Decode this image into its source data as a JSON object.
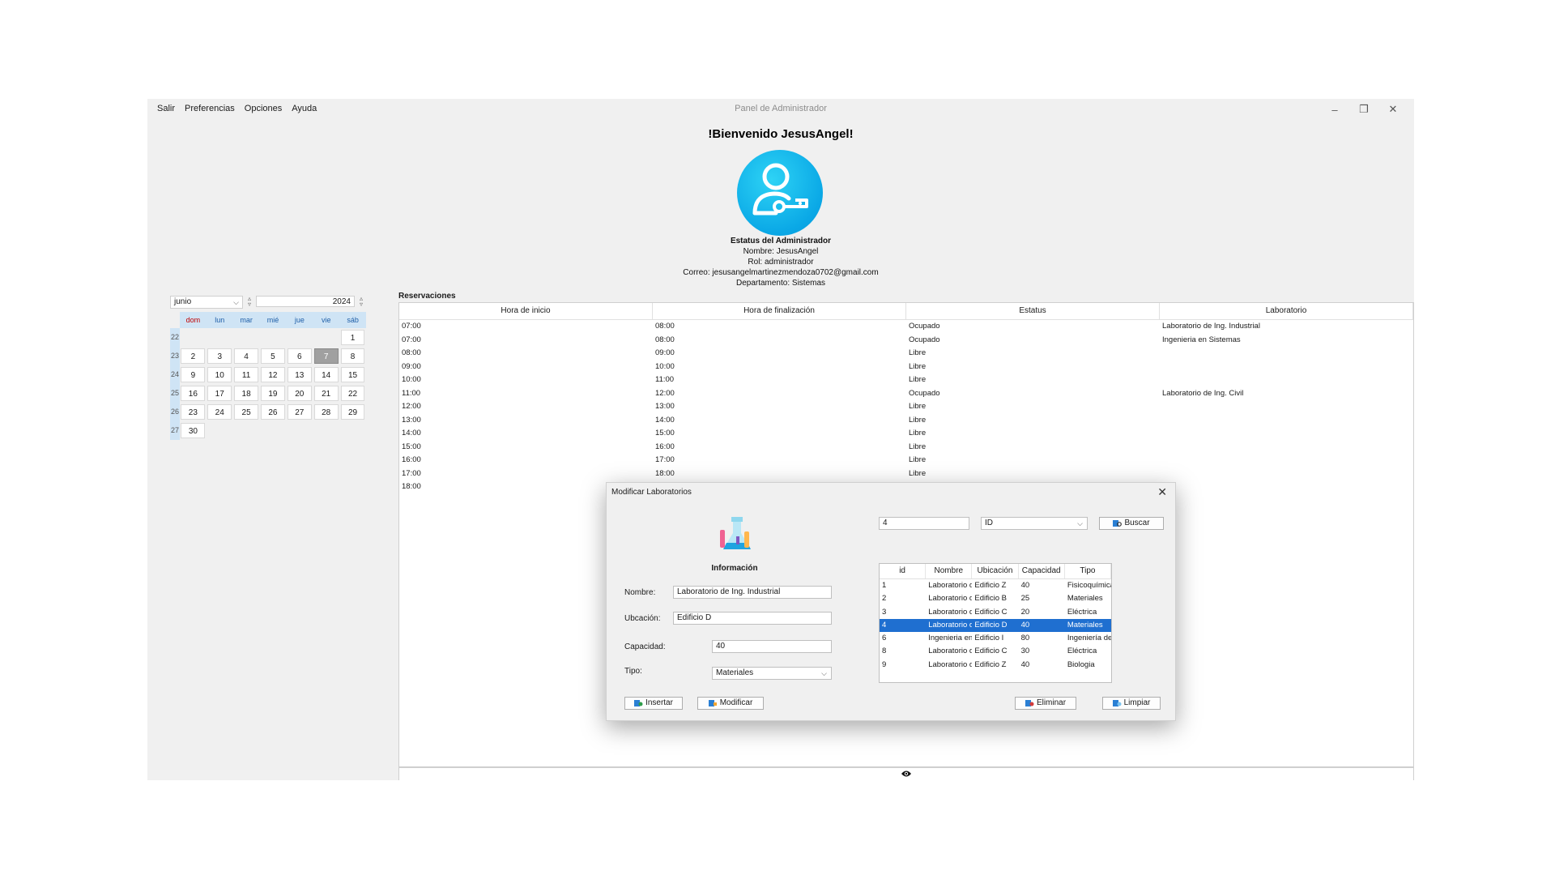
{
  "menu": [
    "Salir",
    "Preferencias",
    "Opciones",
    "Ayuda"
  ],
  "window_title": "Panel de Administrador",
  "welcome": "!Bienvenido JesusAngel!",
  "admin": {
    "heading": "Estatus del Administrador",
    "nombre": "Nombre: JesusAngel",
    "rol": "Rol: administrador",
    "correo": "Correo: jesusangelmartinezmendoza0702@gmail.com",
    "departamento": "Departamento: Sistemas"
  },
  "calendar": {
    "month": "junio",
    "year": "2024",
    "weekdays": [
      "dom",
      "lun",
      "mar",
      "mié",
      "jue",
      "vie",
      "sáb"
    ],
    "selected_day": "7",
    "weeks": [
      {
        "num": "22",
        "days": [
          "",
          "",
          "",
          "",
          "",
          "",
          "1"
        ]
      },
      {
        "num": "23",
        "days": [
          "2",
          "3",
          "4",
          "5",
          "6",
          "7",
          "8"
        ]
      },
      {
        "num": "24",
        "days": [
          "9",
          "10",
          "11",
          "12",
          "13",
          "14",
          "15"
        ]
      },
      {
        "num": "25",
        "days": [
          "16",
          "17",
          "18",
          "19",
          "20",
          "21",
          "22"
        ]
      },
      {
        "num": "26",
        "days": [
          "23",
          "24",
          "25",
          "26",
          "27",
          "28",
          "29"
        ]
      },
      {
        "num": "27",
        "days": [
          "30",
          "",
          "",
          "",
          "",
          "",
          ""
        ]
      }
    ]
  },
  "reservations": {
    "title": "Reservaciones",
    "columns": [
      "Hora de inicio",
      "Hora de finalización",
      "Estatus",
      "Laboratorio"
    ],
    "rows": [
      [
        "07:00",
        "08:00",
        "Ocupado",
        "Laboratorio de Ing. Industrial"
      ],
      [
        "07:00",
        "08:00",
        "Ocupado",
        "Ingenieria en Sistemas"
      ],
      [
        "08:00",
        "09:00",
        "Libre",
        ""
      ],
      [
        "09:00",
        "10:00",
        "Libre",
        ""
      ],
      [
        "10:00",
        "11:00",
        "Libre",
        ""
      ],
      [
        "11:00",
        "12:00",
        "Ocupado",
        "Laboratorio de Ing. Civil"
      ],
      [
        "12:00",
        "13:00",
        "Libre",
        ""
      ],
      [
        "13:00",
        "14:00",
        "Libre",
        ""
      ],
      [
        "14:00",
        "15:00",
        "Libre",
        ""
      ],
      [
        "15:00",
        "16:00",
        "Libre",
        ""
      ],
      [
        "16:00",
        "17:00",
        "Libre",
        ""
      ],
      [
        "17:00",
        "18:00",
        "Libre",
        ""
      ],
      [
        "18:00",
        "",
        "",
        ""
      ]
    ]
  },
  "dialog": {
    "title": "Modificar Laboratorios",
    "info_title": "Información",
    "labels": {
      "nombre": "Nombre:",
      "ubicacion": "Ubcación:",
      "capacidad": "Capacidad:",
      "tipo": "Tipo:"
    },
    "values": {
      "nombre": "Laboratorio de Ing. Industrial",
      "ubicacion": "Edificio D",
      "capacidad": "40",
      "tipo": "Materiales"
    },
    "search_value": "4",
    "search_field": "ID",
    "buttons": {
      "buscar": "Buscar",
      "insertar": "Insertar",
      "modificar": "Modificar",
      "eliminar": "Eliminar",
      "limpiar": "Limpiar"
    },
    "table": {
      "columns": [
        "id",
        "Nombre",
        "Ubicación",
        "Capacidad",
        "Tipo"
      ],
      "selected_index": 3,
      "rows": [
        [
          "1",
          "Laboratorio d...",
          "Edificio Z",
          "40",
          "Fisicoquímica"
        ],
        [
          "2",
          "Laboratorio d...",
          "Edificio B",
          "25",
          "Materiales"
        ],
        [
          "3",
          "Laboratorio d...",
          "Edificio C",
          "20",
          "Eléctrica"
        ],
        [
          "4",
          "Laboratorio d...",
          "Edificio D",
          "40",
          "Materiales"
        ],
        [
          "6",
          "Ingenieria en ...",
          "Edificio I",
          "80",
          "Ingeniería de ..."
        ],
        [
          "8",
          "Laboratorio d...",
          "Edificio C",
          "30",
          "Eléctrica"
        ],
        [
          "9",
          "Laboratorio d...",
          "Edificio Z",
          "40",
          "Biologia"
        ]
      ]
    }
  },
  "colors": {
    "accent": "#1f6fd0",
    "avatar": "#0aa8e6",
    "calendar_header": "#cfe4f5"
  }
}
